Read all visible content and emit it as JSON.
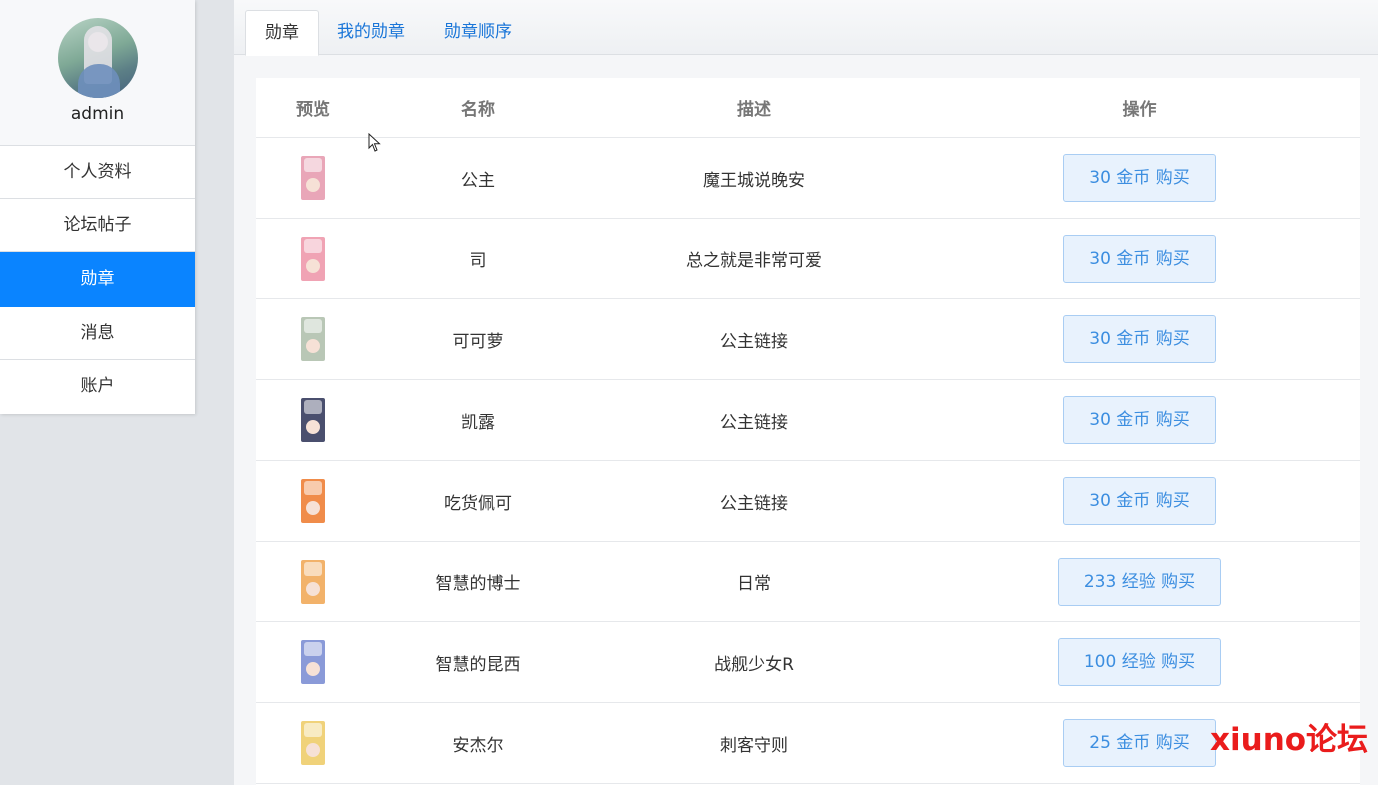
{
  "sidebar": {
    "username": "admin",
    "items": [
      {
        "label": "个人资料",
        "active": false
      },
      {
        "label": "论坛帖子",
        "active": false
      },
      {
        "label": "勋章",
        "active": true
      },
      {
        "label": "消息",
        "active": false
      },
      {
        "label": "账户",
        "active": false
      }
    ]
  },
  "tabs": [
    {
      "label": "勋章",
      "active": true
    },
    {
      "label": "我的勋章",
      "active": false
    },
    {
      "label": "勋章顺序",
      "active": false
    }
  ],
  "table": {
    "headers": [
      "预览",
      "名称",
      "描述",
      "操作"
    ],
    "rows": [
      {
        "name": "公主",
        "desc": "魔王城说晚安",
        "action": "30 金币 购买",
        "thumb_color": "#e9a6b8"
      },
      {
        "name": "司",
        "desc": "总之就是非常可爱",
        "action": "30 金币 购买",
        "thumb_color": "#f0a3b4"
      },
      {
        "name": "可可萝",
        "desc": "公主链接",
        "action": "30 金币 购买",
        "thumb_color": "#b9c7b6"
      },
      {
        "name": "凯露",
        "desc": "公主链接",
        "action": "30 金币 购买",
        "thumb_color": "#4a4f6e"
      },
      {
        "name": "吃货佩可",
        "desc": "公主链接",
        "action": "30 金币 购买",
        "thumb_color": "#f08c4a"
      },
      {
        "name": "智慧的博士",
        "desc": "日常",
        "action": "233 经验 购买",
        "thumb_color": "#f2b26a"
      },
      {
        "name": "智慧的昆西",
        "desc": "战舰少女R",
        "action": "100 经验 购买",
        "thumb_color": "#8a9ad8"
      },
      {
        "name": "安杰尔",
        "desc": "刺客守则",
        "action": "25 金币 购买",
        "thumb_color": "#f0d27a"
      }
    ]
  },
  "watermark": "xiuno论坛",
  "colors": {
    "accent": "#0a84ff",
    "link": "#1b76d8",
    "button_bg": "#e8f2fd",
    "watermark": "#ea1c1c"
  }
}
